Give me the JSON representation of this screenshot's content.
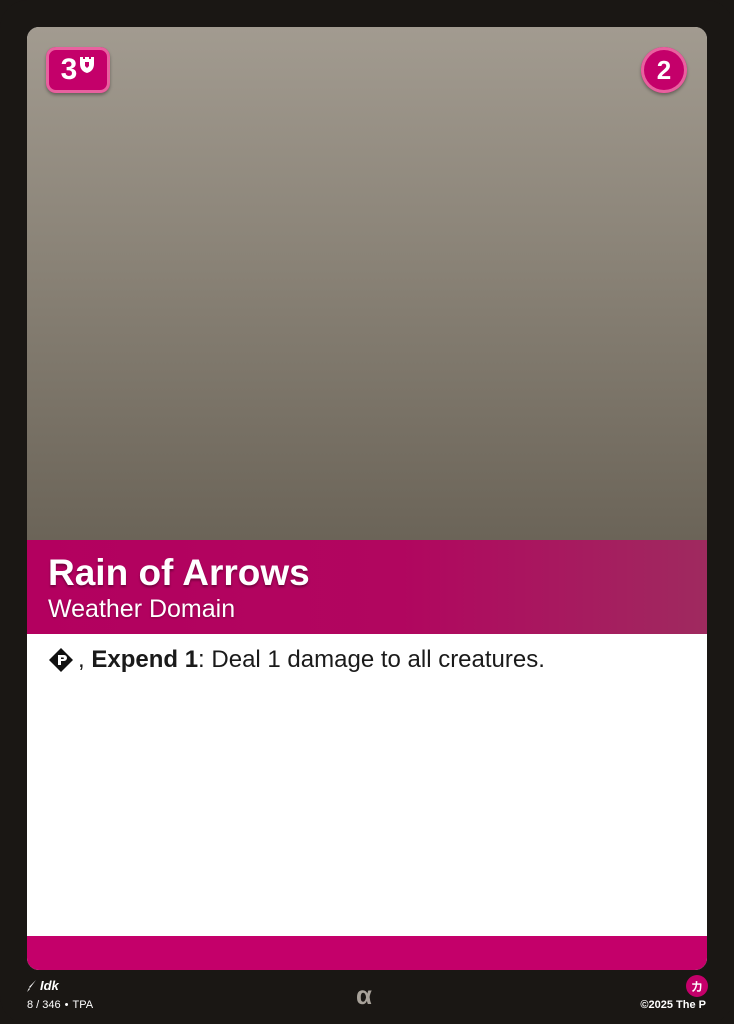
{
  "card": {
    "cost": "3",
    "cost_icon": "tower-shield-icon",
    "level": "2",
    "title": "Rain of Arrows",
    "subtitle": "Weather Domain",
    "rules": {
      "action_icon": "action-diamond-icon",
      "separator": ", ",
      "keyword": "Expend 1",
      "colon": ":",
      "text": " Deal 1 damage to all creatures."
    }
  },
  "footer": {
    "artist": "Idk",
    "collector_number": "8 / 346",
    "bullet": "•",
    "set_code": "TPA",
    "rarity_symbol": "α",
    "language_badge": "カ",
    "copyright": "©2025 The P"
  },
  "colors": {
    "frame": "#1a1714",
    "accent": "#c4006a",
    "accent_light": "#e8619f",
    "art_top": "#a29b90",
    "art_bottom": "#6b6458",
    "text_box": "#ffffff"
  }
}
